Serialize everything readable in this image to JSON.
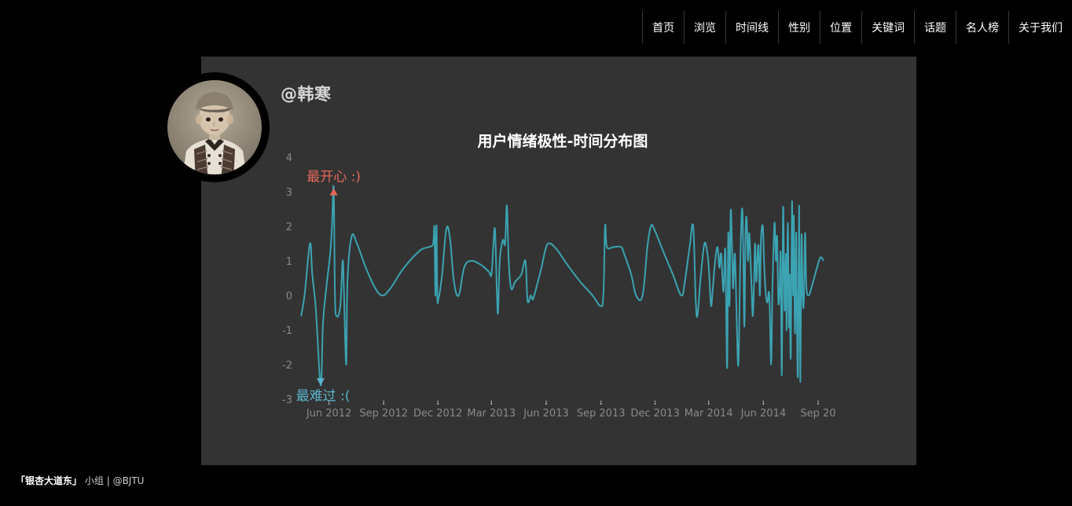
{
  "nav": {
    "items": [
      "首页",
      "浏览",
      "时间线",
      "性别",
      "位置",
      "关键词",
      "话题",
      "名人榜",
      "关于我们"
    ]
  },
  "profile": {
    "username": "@韩寒"
  },
  "chart_data": {
    "type": "line",
    "title": "用户情绪极性-时间分布图",
    "xlabel": "",
    "ylabel": "",
    "ylim": [
      -3,
      4
    ],
    "yticks": [
      4,
      3,
      2,
      1,
      0,
      -1,
      -2,
      -3
    ],
    "xlim": [
      "2012-04-15",
      "2014-10-04"
    ],
    "xtick_dates": [
      "2012-06-01",
      "2012-09-01",
      "2012-12-01",
      "2013-03-01",
      "2013-06-01",
      "2013-09-01",
      "2013-12-01",
      "2014-03-01",
      "2014-06-01",
      "2014-09-01"
    ],
    "xtick_labels": [
      "Jun 2012",
      "Sep 2012",
      "Dec 2012",
      "Mar 2013",
      "Jun 2013",
      "Sep 2013",
      "Dec 2013",
      "Mar 2014",
      "Jun 2014",
      "Sep 20"
    ],
    "grid": false,
    "series_color": "#3ba3b2",
    "series": [
      {
        "points": [
          [
            "2012-04-15",
            -0.6
          ],
          [
            "2012-04-21",
            0.0
          ],
          [
            "2012-04-30",
            1.5
          ],
          [
            "2012-05-04",
            0.6
          ],
          [
            "2012-05-10",
            -0.4
          ],
          [
            "2012-05-18",
            -2.6
          ],
          [
            "2012-05-22",
            -0.8
          ],
          [
            "2012-05-28",
            0.3
          ],
          [
            "2012-06-03",
            1.2
          ],
          [
            "2012-06-06",
            2.0
          ],
          [
            "2012-06-09",
            3.1
          ],
          [
            "2012-06-11",
            0.0
          ],
          [
            "2012-06-14",
            -0.6
          ],
          [
            "2012-06-20",
            -0.3
          ],
          [
            "2012-06-24",
            1.0
          ],
          [
            "2012-06-26",
            0.2
          ],
          [
            "2012-06-30",
            -2.0
          ],
          [
            "2012-07-02",
            0.4
          ],
          [
            "2012-07-09",
            1.7
          ],
          [
            "2012-07-18",
            1.5
          ],
          [
            "2012-08-02",
            0.8
          ],
          [
            "2012-08-18",
            0.2
          ],
          [
            "2012-08-30",
            0.0
          ],
          [
            "2012-09-12",
            0.2
          ],
          [
            "2012-10-05",
            0.8
          ],
          [
            "2012-11-01",
            1.3
          ],
          [
            "2012-11-16",
            1.4
          ],
          [
            "2012-11-23",
            1.5
          ],
          [
            "2012-11-25",
            2.0
          ],
          [
            "2012-11-26",
            1.0
          ],
          [
            "2012-11-27",
            0.0
          ],
          [
            "2012-11-28",
            1.6
          ],
          [
            "2012-11-29",
            1.9
          ],
          [
            "2012-11-30",
            0.0
          ],
          [
            "2012-12-02",
            -0.1
          ],
          [
            "2012-12-08",
            0.6
          ],
          [
            "2012-12-15",
            1.9
          ],
          [
            "2012-12-21",
            1.7
          ],
          [
            "2012-12-28",
            0.4
          ],
          [
            "2013-01-05",
            0.0
          ],
          [
            "2013-01-14",
            0.8
          ],
          [
            "2013-01-25",
            1.0
          ],
          [
            "2013-02-10",
            0.9
          ],
          [
            "2013-02-24",
            0.7
          ],
          [
            "2013-03-01",
            0.6
          ],
          [
            "2013-03-04",
            1.4
          ],
          [
            "2013-03-07",
            1.9
          ],
          [
            "2013-03-10",
            0.2
          ],
          [
            "2013-03-12",
            -0.5
          ],
          [
            "2013-03-15",
            1.0
          ],
          [
            "2013-03-20",
            1.6
          ],
          [
            "2013-03-24",
            1.5
          ],
          [
            "2013-03-27",
            2.6
          ],
          [
            "2013-03-30",
            1.0
          ],
          [
            "2013-04-03",
            0.2
          ],
          [
            "2013-04-10",
            0.4
          ],
          [
            "2013-04-20",
            0.6
          ],
          [
            "2013-04-27",
            1.0
          ],
          [
            "2013-04-30",
            0.0
          ],
          [
            "2013-05-02",
            -0.2
          ],
          [
            "2013-05-06",
            0.0
          ],
          [
            "2013-05-10",
            -0.1
          ],
          [
            "2013-05-18",
            0.4
          ],
          [
            "2013-05-24",
            0.8
          ],
          [
            "2013-06-01",
            1.4
          ],
          [
            "2013-06-08",
            1.5
          ],
          [
            "2013-06-20",
            1.3
          ],
          [
            "2013-07-06",
            0.9
          ],
          [
            "2013-07-28",
            0.4
          ],
          [
            "2013-08-18",
            0.0
          ],
          [
            "2013-08-31",
            -0.3
          ],
          [
            "2013-09-05",
            0.0
          ],
          [
            "2013-09-08",
            2.0
          ],
          [
            "2013-09-11",
            1.4
          ],
          [
            "2013-09-22",
            1.4
          ],
          [
            "2013-10-05",
            1.4
          ],
          [
            "2013-10-10",
            1.2
          ],
          [
            "2013-10-22",
            0.6
          ],
          [
            "2013-10-30",
            0.0
          ],
          [
            "2013-11-10",
            0.0
          ],
          [
            "2013-11-18",
            1.4
          ],
          [
            "2013-11-24",
            2.0
          ],
          [
            "2013-11-30",
            1.9
          ],
          [
            "2013-12-14",
            1.3
          ],
          [
            "2013-12-31",
            0.6
          ],
          [
            "2014-01-14",
            0.0
          ],
          [
            "2014-01-20",
            0.4
          ],
          [
            "2014-01-28",
            1.4
          ],
          [
            "2014-02-03",
            2.0
          ],
          [
            "2014-02-07",
            0.0
          ],
          [
            "2014-02-10",
            -0.6
          ],
          [
            "2014-02-16",
            0.6
          ],
          [
            "2014-02-22",
            1.5
          ],
          [
            "2014-02-27",
            1.2
          ],
          [
            "2014-03-02",
            0.6
          ],
          [
            "2014-03-05",
            -0.3
          ],
          [
            "2014-03-08",
            0.2
          ],
          [
            "2014-03-12",
            1.0
          ],
          [
            "2014-03-16",
            1.4
          ],
          [
            "2014-03-19",
            0.8
          ],
          [
            "2014-03-22",
            1.2
          ],
          [
            "2014-03-26",
            0.1
          ],
          [
            "2014-03-29",
            1.3
          ],
          [
            "2014-04-01",
            -2.1
          ],
          [
            "2014-04-03",
            1.8
          ],
          [
            "2014-04-05",
            -0.3
          ],
          [
            "2014-04-07",
            2.4
          ],
          [
            "2014-04-09",
            1.6
          ],
          [
            "2014-04-11",
            0.2
          ],
          [
            "2014-04-14",
            1.2
          ],
          [
            "2014-04-17",
            -0.6
          ],
          [
            "2014-04-20",
            -2.0
          ],
          [
            "2014-04-23",
            0.8
          ],
          [
            "2014-04-26",
            2.5
          ],
          [
            "2014-04-28",
            1.5
          ],
          [
            "2014-04-30",
            -0.9
          ],
          [
            "2014-05-02",
            1.8
          ],
          [
            "2014-05-04",
            2.2
          ],
          [
            "2014-05-06",
            1.0
          ],
          [
            "2014-05-08",
            1.8
          ],
          [
            "2014-05-10",
            1.2
          ],
          [
            "2014-05-12",
            0.3
          ],
          [
            "2014-05-14",
            -0.6
          ],
          [
            "2014-05-16",
            0.2
          ],
          [
            "2014-05-18",
            1.5
          ],
          [
            "2014-05-20",
            0.4
          ],
          [
            "2014-05-22",
            1.1
          ],
          [
            "2014-05-24",
            1.4
          ],
          [
            "2014-05-26",
            0.0
          ],
          [
            "2014-05-28",
            1.6
          ],
          [
            "2014-05-31",
            2.0
          ],
          [
            "2014-06-02",
            1.0
          ],
          [
            "2014-06-04",
            0.3
          ],
          [
            "2014-06-06",
            -0.1
          ],
          [
            "2014-06-08",
            -0.2
          ],
          [
            "2014-06-11",
            0.0
          ],
          [
            "2014-06-14",
            -2.0
          ],
          [
            "2014-06-16",
            0.1
          ],
          [
            "2014-06-18",
            1.4
          ],
          [
            "2014-06-20",
            2.1
          ],
          [
            "2014-06-22",
            1.0
          ],
          [
            "2014-06-24",
            1.7
          ],
          [
            "2014-06-26",
            -0.1
          ],
          [
            "2014-06-28",
            0.0
          ],
          [
            "2014-06-30",
            1.2
          ],
          [
            "2014-07-02",
            -2.3
          ],
          [
            "2014-07-04",
            2.5
          ],
          [
            "2014-07-06",
            0.3
          ],
          [
            "2014-07-07",
            -0.4
          ],
          [
            "2014-07-09",
            1.2
          ],
          [
            "2014-07-10",
            -1.0
          ],
          [
            "2014-07-12",
            2.1
          ],
          [
            "2014-07-14",
            -0.9
          ],
          [
            "2014-07-15",
            0.6
          ],
          [
            "2014-07-17",
            -1.8
          ],
          [
            "2014-07-19",
            2.7
          ],
          [
            "2014-07-21",
            0.0
          ],
          [
            "2014-07-22",
            2.3
          ],
          [
            "2014-07-24",
            -1.1
          ],
          [
            "2014-07-26",
            1.8
          ],
          [
            "2014-07-27",
            0.0
          ],
          [
            "2014-07-29",
            -2.3
          ],
          [
            "2014-07-31",
            2.6
          ],
          [
            "2014-08-02",
            -2.5
          ],
          [
            "2014-08-04",
            1.7
          ],
          [
            "2014-08-06",
            0.0
          ],
          [
            "2014-08-08",
            -0.2
          ],
          [
            "2014-08-10",
            1.8
          ],
          [
            "2014-08-12",
            0.3
          ],
          [
            "2014-08-16",
            0.0
          ],
          [
            "2014-08-22",
            0.3
          ],
          [
            "2014-08-30",
            0.8
          ],
          [
            "2014-09-05",
            1.1
          ],
          [
            "2014-09-10",
            1.0
          ]
        ]
      }
    ],
    "annotations": {
      "max": {
        "label": "最开心 :)",
        "date": "2012-06-09",
        "value": 3.1,
        "color": "#e8685a"
      },
      "min": {
        "label": "最难过 :(",
        "date": "2012-05-18",
        "value": -2.6,
        "color": "#5ab4cc"
      }
    }
  },
  "footer": {
    "brand": "「银杏大道东」",
    "group": "小组",
    "separator": "|",
    "handle": "@BJTU"
  }
}
